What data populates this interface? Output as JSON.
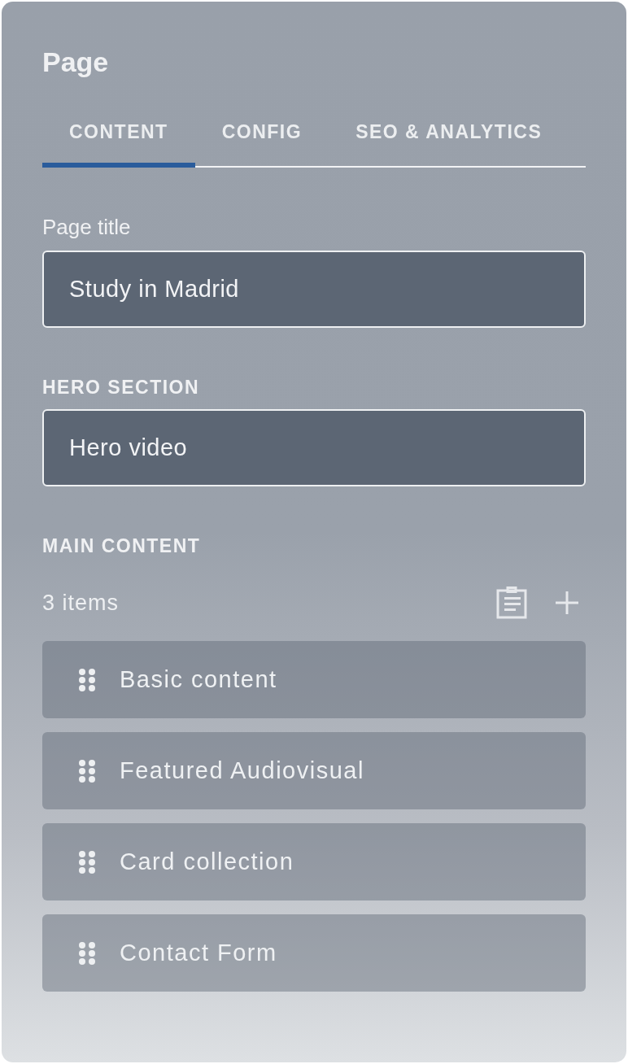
{
  "panel": {
    "title": "Page"
  },
  "tabs": [
    {
      "label": "CONTENT",
      "selected": true
    },
    {
      "label": "CONFIG",
      "selected": false
    },
    {
      "label": "SEO & ANALYTICS",
      "selected": false
    }
  ],
  "page_title": {
    "label": "Page title",
    "value": "Study in Madrid"
  },
  "hero_section": {
    "heading": "HERO SECTION",
    "value": "Hero video"
  },
  "main_content": {
    "heading": "MAIN CONTENT",
    "count": "3 items",
    "items": [
      {
        "label": "Basic content"
      },
      {
        "label": "Featured Audiovisual"
      },
      {
        "label": "Card collection"
      },
      {
        "label": "Contact Form"
      }
    ]
  }
}
